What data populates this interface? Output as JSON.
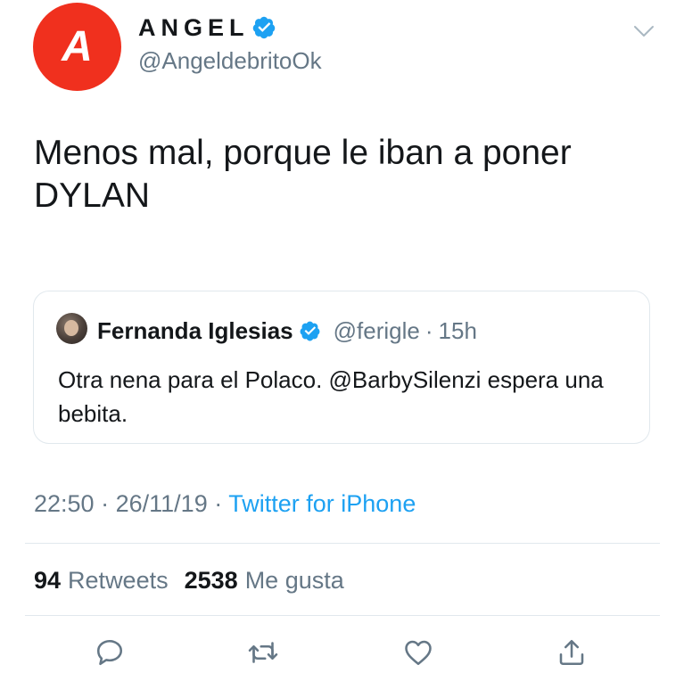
{
  "author": {
    "avatar_letter": "A",
    "display_name": "ANGEL",
    "handle": "@AngeldebritoOk",
    "verified": true
  },
  "tweet": {
    "text": "Menos mal, porque le iban a poner\nDYLAN"
  },
  "quoted_tweet": {
    "display_name": "Fernanda Iglesias",
    "handle": "@ferigle",
    "separator": "·",
    "time": "15h",
    "verified": true,
    "text": "Otra nena para el Polaco. @BarbySilenzi espera una bebita."
  },
  "meta": {
    "time": "22:50",
    "sep1": "·",
    "date": "26/11/19",
    "sep2": "·",
    "source": "Twitter for iPhone"
  },
  "stats": {
    "retweets_count": "94",
    "retweets_label": "Retweets",
    "likes_count": "2538",
    "likes_label": "Me gusta"
  },
  "actions": {
    "icons": [
      "reply-icon",
      "retweet-icon",
      "like-icon",
      "share-icon"
    ]
  },
  "colors": {
    "avatar_red": "#f0301e",
    "verified_blue": "#1da1f2",
    "link_blue": "#1da1f2",
    "secondary_text": "#657786",
    "divider": "#e1e8ed"
  }
}
